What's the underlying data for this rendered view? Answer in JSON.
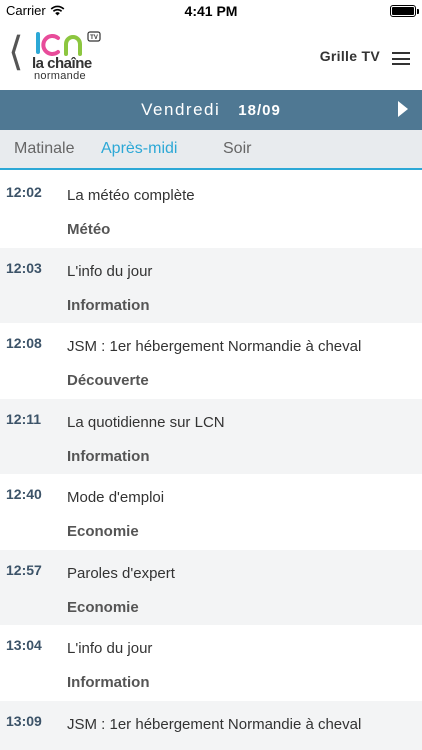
{
  "status_bar": {
    "carrier": "Carrier",
    "time": "4:41 PM"
  },
  "header": {
    "grille_label": "Grille TV"
  },
  "day_bar": {
    "day": "Vendredi",
    "date": "18/09"
  },
  "tabs": [
    {
      "label": "Matinale",
      "active": false
    },
    {
      "label": "Après-midi",
      "active": true
    },
    {
      "label": "Soir",
      "active": false
    }
  ],
  "schedule": [
    {
      "time": "12:02",
      "title": "La météo complète",
      "category": "Météo"
    },
    {
      "time": "12:03",
      "title": "L'info du jour",
      "category": "Information"
    },
    {
      "time": "12:08",
      "title": "JSM : 1er hébergement Normandie à cheval",
      "category": "Découverte"
    },
    {
      "time": "12:11",
      "title": "La quotidienne sur LCN",
      "category": "Information"
    },
    {
      "time": "12:40",
      "title": "Mode d'emploi",
      "category": "Economie"
    },
    {
      "time": "12:57",
      "title": "Paroles d'expert",
      "category": "Economie"
    },
    {
      "time": "13:04",
      "title": "L'info du jour",
      "category": "Information"
    },
    {
      "time": "13:09",
      "title": "JSM : 1er hébergement Normandie à cheval",
      "category": ""
    }
  ],
  "colors": {
    "header_bar": "#4f7893",
    "accent": "#2ca8d6",
    "tabs_bg": "#e8ebee",
    "time_text": "#3c5368"
  },
  "icons": {
    "back": "chevron-left-icon",
    "menu": "hamburger-menu-icon",
    "next": "play-right-icon",
    "wifi": "wifi-icon",
    "battery": "battery-icon"
  }
}
